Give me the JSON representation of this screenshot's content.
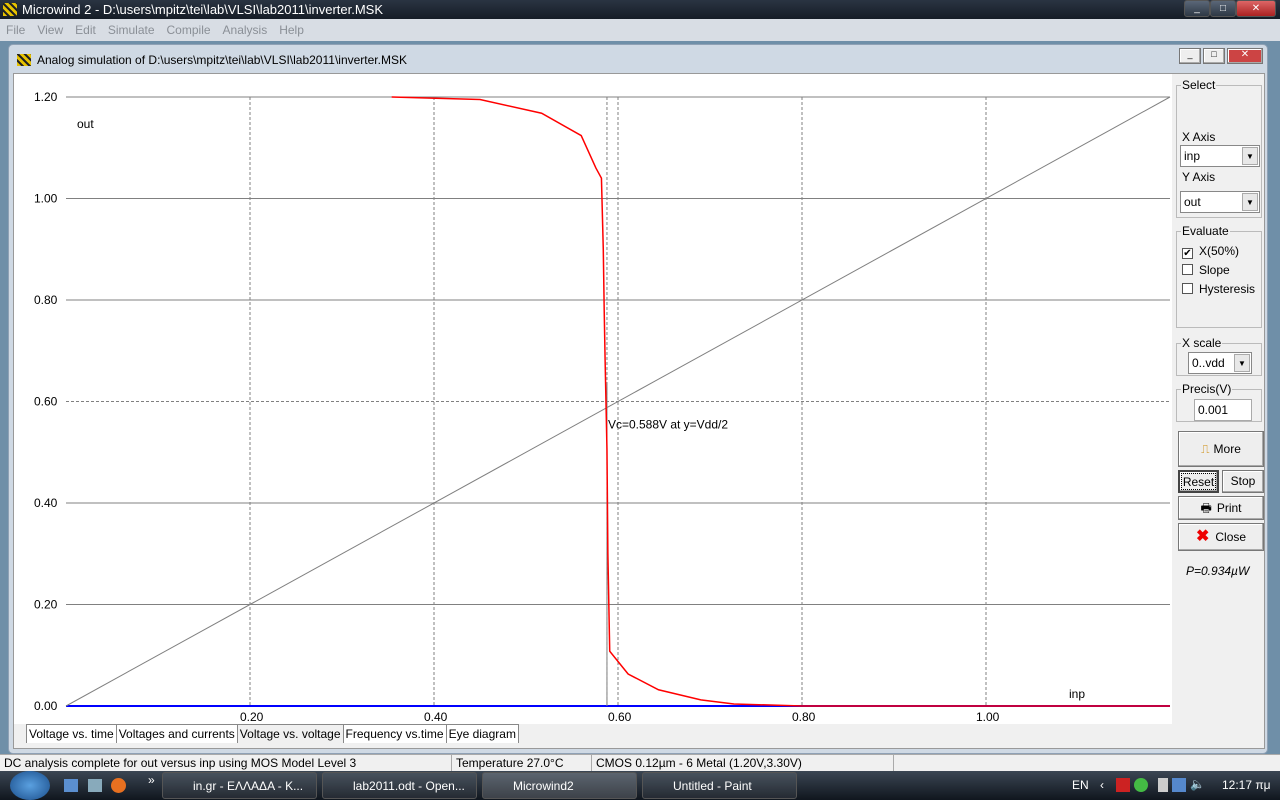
{
  "app": {
    "title": "Microwind 2 - D:\\users\\mpitz\\tei\\lab\\VLSI\\lab2011\\inverter.MSK",
    "menu": [
      "File",
      "View",
      "Edit",
      "Simulate",
      "Compile",
      "Analysis",
      "Help"
    ]
  },
  "window": {
    "title": "Analog simulation of D:\\users\\mpitz\\tei\\lab\\VLSI\\lab2011\\inverter.MSK"
  },
  "panel": {
    "select_label": "Select",
    "x_axis_label": "X Axis",
    "x_axis_value": "inp",
    "y_axis_label": "Y Axis",
    "y_axis_value": "out",
    "evaluate_label": "Evaluate",
    "checks": [
      {
        "label": "X(50%)",
        "checked": true
      },
      {
        "label": "Slope",
        "checked": false
      },
      {
        "label": "Hysteresis",
        "checked": false
      }
    ],
    "xscale_label": "X scale",
    "xscale_value": "0..vdd",
    "precis_label": "Precis(V)",
    "precis_value": "0.001",
    "more": "More",
    "reset": "Reset",
    "stop": "Stop",
    "print": "Print",
    "close": "Close",
    "power": "P=0.934µW"
  },
  "tabs": [
    "Voltage vs. time",
    "Voltages and currents",
    "Voltage vs. voltage",
    "Frequency vs.time",
    "Eye diagram"
  ],
  "active_tab": 2,
  "status": {
    "message": "DC analysis complete for out versus inp using MOS Model Level 3",
    "temperature": "Temperature 27.0°C",
    "technology": "CMOS 0.12µm - 6 Metal (1.20V,3.30V)"
  },
  "taskbar": {
    "items": [
      "in.gr - ΕΛΛΑΔΑ - K...",
      "lab2011.odt - Open...",
      "Microwind2",
      "Untitled - Paint"
    ],
    "active": 2,
    "lang": "EN",
    "clock": "12:17 πμ"
  },
  "chart_data": {
    "type": "line",
    "xlabel": "inp",
    "ylabel": "out",
    "xlim": [
      0,
      1.2
    ],
    "ylim": [
      0,
      1.2
    ],
    "grid": true,
    "xticks": [
      "0.20",
      "0.40",
      "0.60",
      "0.80",
      "1.00"
    ],
    "yticks": [
      "0.00",
      "0.20",
      "0.40",
      "0.60",
      "0.80",
      "1.00",
      "1.20"
    ],
    "series": [
      {
        "color": "#ff0000",
        "points": [
          [
            0.354,
            1.2
          ],
          [
            0.45,
            1.195
          ],
          [
            0.517,
            1.168
          ],
          [
            0.56,
            1.124
          ],
          [
            0.576,
            1.06
          ],
          [
            0.582,
            1.04
          ],
          [
            0.584,
            0.9
          ],
          [
            0.585,
            0.78
          ],
          [
            0.586,
            0.68
          ],
          [
            0.588,
            0.506
          ],
          [
            0.589,
            0.3
          ],
          [
            0.591,
            0.108
          ],
          [
            0.611,
            0.063
          ],
          [
            0.644,
            0.032
          ],
          [
            0.69,
            0.012
          ],
          [
            0.726,
            0.004
          ],
          [
            0.8,
            0.0
          ],
          [
            1.2,
            0.0
          ]
        ]
      },
      {
        "color": "#808080",
        "points": [
          [
            0,
            0
          ],
          [
            1.2,
            1.2
          ]
        ]
      }
    ],
    "annotation": {
      "text": "Vc=0.588V at y=Vdd/2",
      "vc": 0.588,
      "y": 0.6
    }
  }
}
